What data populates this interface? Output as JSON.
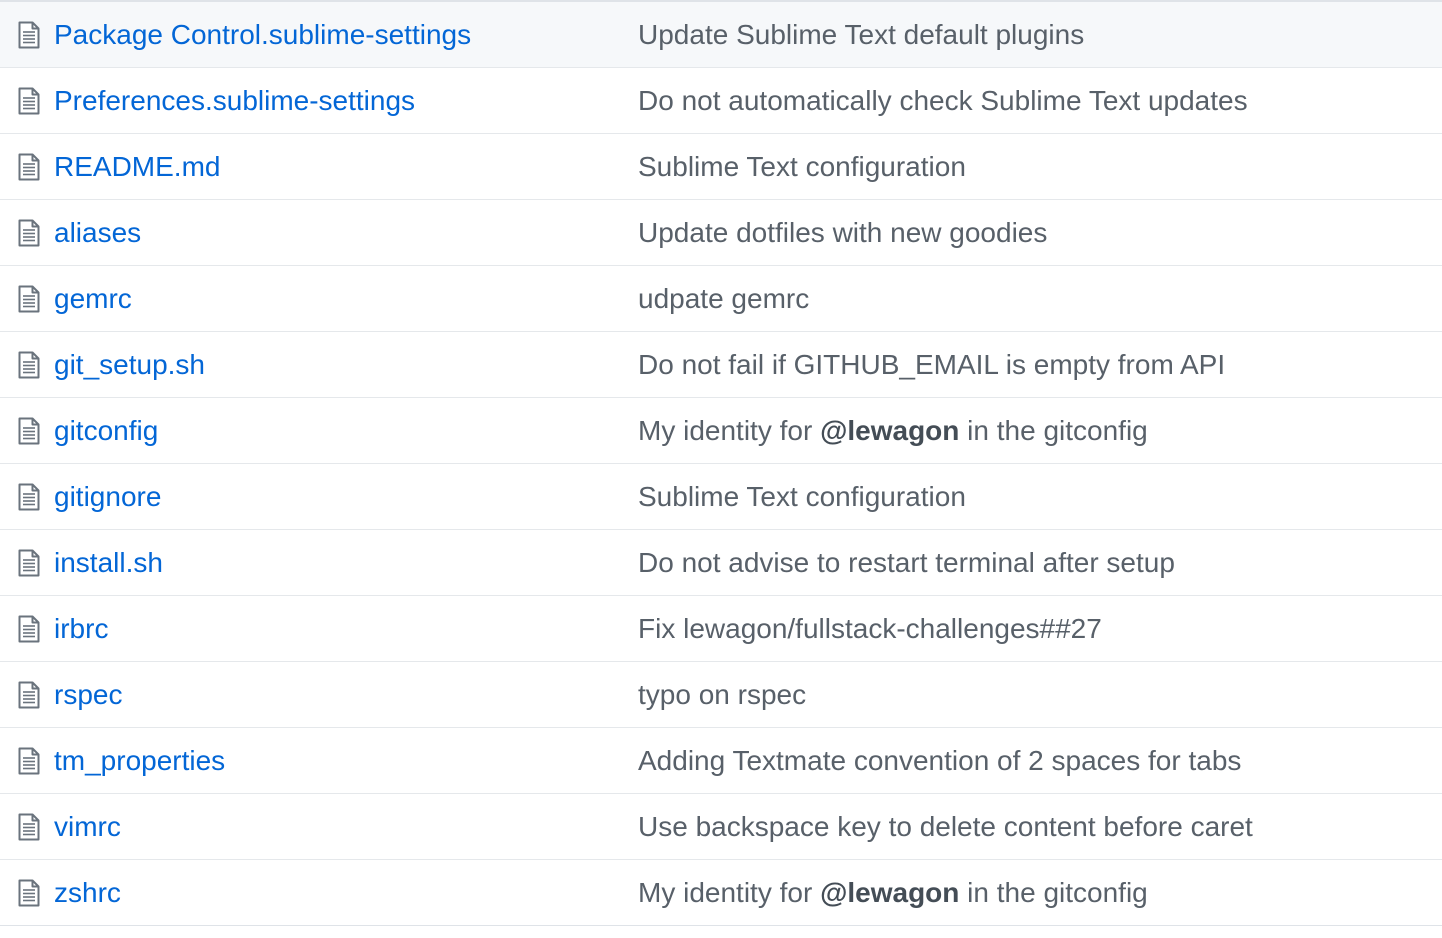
{
  "colors": {
    "link": "#0366d6",
    "message": "#586069",
    "icon": "#6a737d",
    "border": "#e5e8eb",
    "hover_row": "#f6f8fa"
  },
  "files": [
    {
      "icon": "file-icon",
      "name": "Package Control.sublime-settings",
      "message": {
        "before": "Update Sublime Text default plugins",
        "mention": "",
        "after": ""
      }
    },
    {
      "icon": "file-icon",
      "name": "Preferences.sublime-settings",
      "message": {
        "before": "Do not automatically check Sublime Text updates",
        "mention": "",
        "after": ""
      }
    },
    {
      "icon": "file-icon",
      "name": "README.md",
      "message": {
        "before": "Sublime Text configuration",
        "mention": "",
        "after": ""
      }
    },
    {
      "icon": "file-icon",
      "name": "aliases",
      "message": {
        "before": "Update dotfiles with new goodies",
        "mention": "",
        "after": ""
      }
    },
    {
      "icon": "file-icon",
      "name": "gemrc",
      "message": {
        "before": "udpate gemrc",
        "mention": "",
        "after": ""
      }
    },
    {
      "icon": "file-icon",
      "name": "git_setup.sh",
      "message": {
        "before": "Do not fail if GITHUB_EMAIL is empty from API",
        "mention": "",
        "after": ""
      }
    },
    {
      "icon": "file-icon",
      "name": "gitconfig",
      "message": {
        "before": "My identity for ",
        "mention": "@lewagon",
        "after": " in the gitconfig"
      }
    },
    {
      "icon": "file-icon",
      "name": "gitignore",
      "message": {
        "before": "Sublime Text configuration",
        "mention": "",
        "after": ""
      }
    },
    {
      "icon": "file-icon",
      "name": "install.sh",
      "message": {
        "before": "Do not advise to restart terminal after setup",
        "mention": "",
        "after": ""
      }
    },
    {
      "icon": "file-icon",
      "name": "irbrc",
      "message": {
        "before": "Fix lewagon/fullstack-challenges##27",
        "mention": "",
        "after": ""
      }
    },
    {
      "icon": "file-icon",
      "name": "rspec",
      "message": {
        "before": "typo on rspec",
        "mention": "",
        "after": ""
      }
    },
    {
      "icon": "file-icon",
      "name": "tm_properties",
      "message": {
        "before": "Adding Textmate convention of 2 spaces for tabs",
        "mention": "",
        "after": ""
      }
    },
    {
      "icon": "file-icon",
      "name": "vimrc",
      "message": {
        "before": "Use backspace key to delete content before caret",
        "mention": "",
        "after": ""
      }
    },
    {
      "icon": "file-icon",
      "name": "zshrc",
      "message": {
        "before": "My identity for ",
        "mention": "@lewagon",
        "after": " in the gitconfig"
      }
    }
  ]
}
